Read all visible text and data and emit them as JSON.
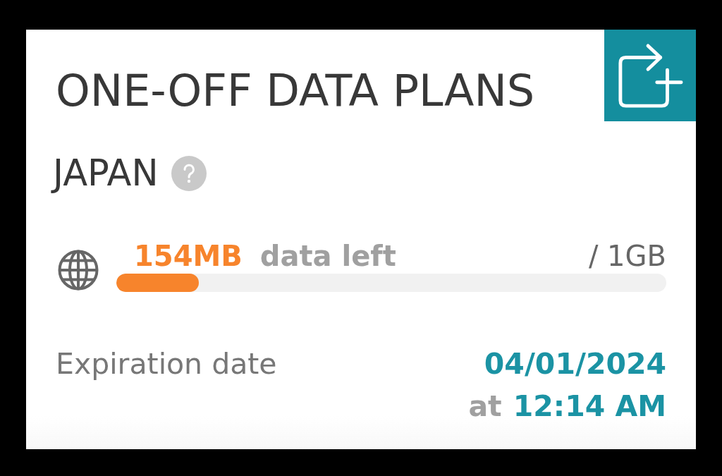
{
  "title": "ONE-OFF DATA PLANS",
  "plan": {
    "country": "JAPAN",
    "usage": {
      "remaining": "154MB",
      "remaining_label": "data left",
      "total": "/ 1GB",
      "level": 0.15
    },
    "expiration": {
      "label": "Expiration date",
      "date": "04/01/2024",
      "time_prefix": "at",
      "time": "12:14 AM"
    }
  }
}
